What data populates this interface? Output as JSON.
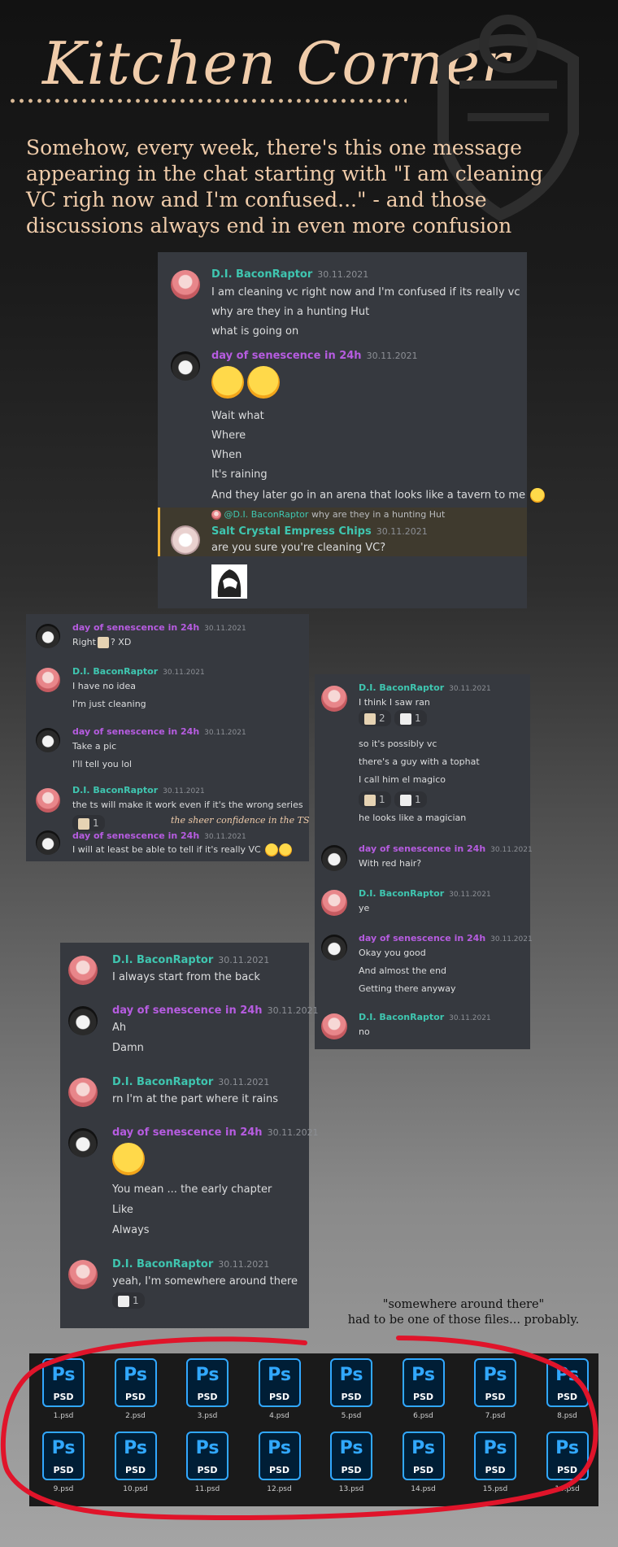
{
  "header": {
    "title": "Kitchen Corner",
    "intro": "Somehow, every week, there's this one message appearing in the chat starting with \"I am cleaning VC righ now and I'm confused...\" - and those discussions always end in even more confusion"
  },
  "panel1": {
    "m1": {
      "user": "D.I. BaconRaptor",
      "time": "30.11.2021",
      "lines": [
        "I am cleaning vc right now and I'm confused if its really vc",
        "why are they in a hunting Hut",
        "what is going on"
      ]
    },
    "m2": {
      "user": "day of senescence in 24h",
      "time": "30.11.2021",
      "lines": [
        "Wait what",
        "Where",
        "When",
        "It's raining",
        "And they later go in an arena that looks like a tavern to me"
      ]
    },
    "m3": {
      "reply_user": "@D.I. BaconRaptor",
      "reply_text": "why are they in a hunting Hut",
      "user": "Salt Crystal Empress Chips",
      "time": "30.11.2021",
      "lines": [
        "are you sure you're cleaning VC?"
      ]
    }
  },
  "panel2": {
    "m1": {
      "user": "day of senescence in 24h",
      "time": "30.11.2021",
      "text_a": "Right",
      "text_b": "? XD"
    },
    "m2": {
      "user": "D.I. BaconRaptor",
      "time": "30.11.2021",
      "lines": [
        "I have no idea",
        "I'm just cleaning"
      ]
    },
    "m3": {
      "user": "day of senescence in 24h",
      "time": "30.11.2021",
      "lines": [
        "Take a pic",
        "I'll tell you lol"
      ]
    },
    "m4": {
      "user": "D.I. BaconRaptor",
      "time": "30.11.2021",
      "lines": [
        "the ts will make it work even if it's the wrong series"
      ],
      "reaction": "1",
      "note": "the sheer confidence in the TS"
    },
    "m5": {
      "user": "day of senescence in 24h",
      "time": "30.11.2021",
      "lines": [
        "I will at least be able to tell if it's really VC"
      ]
    }
  },
  "panel3": {
    "m1": {
      "user": "D.I. BaconRaptor",
      "time": "30.11.2021",
      "lines": [
        "I think I saw ran",
        "so it's possibly vc",
        "there's a guy with a tophat",
        "I call him el magico",
        "he looks like a magician"
      ],
      "r1a": "2",
      "r1b": "1",
      "r2a": "1",
      "r2b": "1"
    },
    "m2": {
      "user": "day of senescence in 24h",
      "time": "30.11.2021",
      "lines": [
        "With red hair?"
      ]
    },
    "m3": {
      "user": "D.I. BaconRaptor",
      "time": "30.11.2021",
      "lines": [
        "ye"
      ]
    },
    "m4": {
      "user": "day of senescence in 24h",
      "time": "30.11.2021",
      "lines": [
        "Okay you good",
        "And almost the end",
        "Getting there anyway"
      ]
    },
    "m5": {
      "user": "D.I. BaconRaptor",
      "time": "30.11.2021",
      "lines": [
        "no"
      ]
    }
  },
  "panel4": {
    "m1": {
      "user": "D.I. BaconRaptor",
      "time": "30.11.2021",
      "lines": [
        "I always start from the back"
      ]
    },
    "m2": {
      "user": "day of senescence in 24h",
      "time": "30.11.2021",
      "lines": [
        "Ah",
        "Damn"
      ]
    },
    "m3": {
      "user": "D.I. BaconRaptor",
      "time": "30.11.2021",
      "lines": [
        "rn I'm at the part where it rains"
      ]
    },
    "m4": {
      "user": "day of senescence in 24h",
      "time": "30.11.2021",
      "lines": [
        "You mean ... the early chapter",
        "Like",
        "Always"
      ]
    },
    "m5": {
      "user": "D.I. BaconRaptor",
      "time": "30.11.2021",
      "lines": [
        "yeah, I'm somewhere around there"
      ],
      "reaction": "1"
    }
  },
  "caption": {
    "line1": "\"somewhere around there\"",
    "line2": "had to be one of those files... probably."
  },
  "files": {
    "icon_big": "Ps",
    "icon_small": "PSD",
    "names": [
      "1.psd",
      "2.psd",
      "3.psd",
      "4.psd",
      "5.psd",
      "6.psd",
      "7.psd",
      "8.psd",
      "9.psd",
      "10.psd",
      "11.psd",
      "12.psd",
      "13.psd",
      "14.psd",
      "15.psd",
      "16.psd"
    ]
  },
  "colors": {
    "teal_user": "#3fc6b0",
    "purple_user": "#b65ce0",
    "panel_bg": "#36393f",
    "accent_title": "#f0ccaa",
    "ps_blue": "#31a8ff",
    "marker_red": "#e0142a"
  }
}
